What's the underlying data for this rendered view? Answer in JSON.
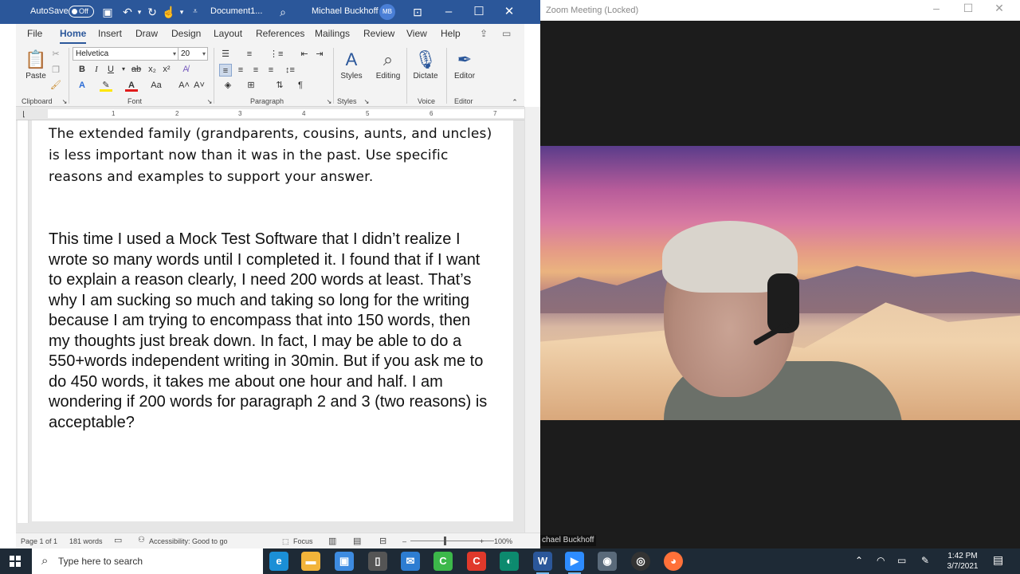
{
  "word": {
    "autosave_label": "AutoSave",
    "autosave_state": "Off",
    "doc_title": "Document1...",
    "user_name": "Michael Buckhoff",
    "user_initials": "MB",
    "tabs": [
      "File",
      "Home",
      "Insert",
      "Draw",
      "Design",
      "Layout",
      "References",
      "Mailings",
      "Review",
      "View",
      "Help"
    ],
    "active_tab": "Home",
    "font_name": "Helvetica",
    "font_size": "20",
    "ribbon": {
      "paste": "Paste",
      "styles": "Styles",
      "editing": "Editing",
      "dictate": "Dictate",
      "editor": "Editor",
      "groups": [
        "Clipboard",
        "Font",
        "Paragraph",
        "Styles",
        "Voice",
        "Editor"
      ]
    },
    "ruler_numbers": [
      "1",
      "2",
      "3",
      "4",
      "5",
      "6",
      "7"
    ],
    "prompt_text": "The extended family (grandparents, cousins, aunts, and uncles) is less important now than it was in the past. Use specific reasons and examples to support your answer.",
    "body_text": "This time I used a Mock Test Software that I didn’t realize I wrote so many words until I completed it. I found that if I want to explain a reason clearly, I need 200 words at least. That’s why I am sucking so much and taking so long for the writing because I am trying to encompass that into 150 words, then my thoughts just break down. In fact, I may be able to do a 550+words independent writing in 30min. But if you ask me to do 450 words, it takes me about one hour and half. I am wondering if 200 words for paragraph 2 and 3 (two reasons) is acceptable?",
    "status": {
      "page": "Page 1 of 1",
      "words": "181 words",
      "accessibility": "Accessibility: Good to go",
      "focus": "Focus",
      "zoom": "100%"
    }
  },
  "zoom": {
    "title": "Zoom Meeting (Locked)",
    "participant_name": "chael Buckhoff"
  },
  "taskbar": {
    "search_placeholder": "Type here to search",
    "time": "1:42 PM",
    "date": "3/7/2021"
  },
  "colors": {
    "word_blue": "#2b579a",
    "taskbar": "#1e2a36"
  }
}
